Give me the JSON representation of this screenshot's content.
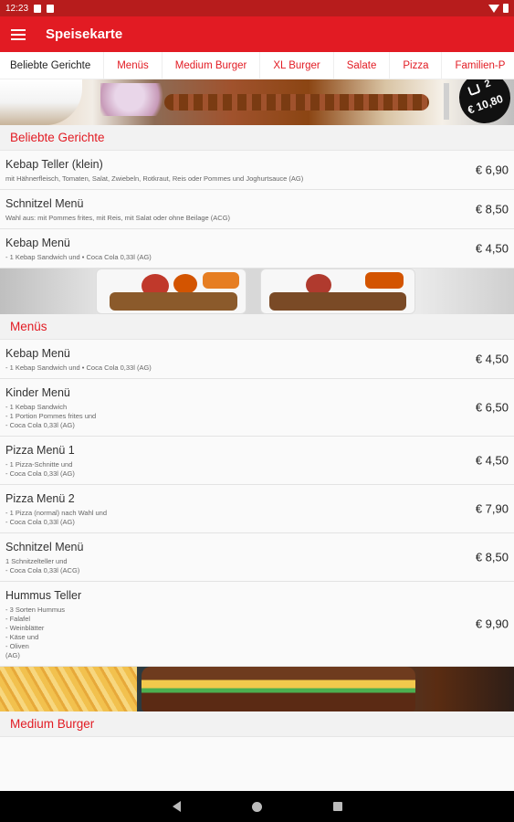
{
  "status_bar": {
    "time": "12:23"
  },
  "app_bar": {
    "title": "Speisekarte"
  },
  "tabs": [
    "Beliebte Gerichte",
    "Menüs",
    "Medium Burger",
    "XL Burger",
    "Salate",
    "Pizza",
    "Familien-P"
  ],
  "cart": {
    "count": "2",
    "total": "€ 10,80"
  },
  "sections": [
    {
      "title": "Beliebte Gerichte",
      "items": [
        {
          "name": "Kebap Teller (klein)",
          "description": "mit Hähnerfleisch, Tomaten, Salat, Zwiebeln, Rotkraut, Reis oder Pommes und Joghurtsauce (AG)",
          "price": "€ 6,90"
        },
        {
          "name": "Schnitzel Menü",
          "description": "Wahl aus: mit Pommes frites, mit Reis, mit Salat oder ohne Beilage (ACG)",
          "price": "€ 8,50"
        },
        {
          "name": "Kebap Menü",
          "description": "- 1 Kebap Sandwich und   • Coca Cola 0,33l  (AG)",
          "price": "€ 4,50"
        }
      ]
    },
    {
      "title": "Menüs",
      "items": [
        {
          "name": "Kebap Menü",
          "description": "- 1 Kebap Sandwich und   • Coca Cola 0,33l  (AG)",
          "price": "€ 4,50"
        },
        {
          "name": "Kinder Menü",
          "description": "- 1 Kebap Sandwich\n- 1 Portion Pommes frites und\n- Coca Cola 0,33l  (AG)",
          "price": "€ 6,50"
        },
        {
          "name": "Pizza Menü 1",
          "description": "- 1 Pizza-Schnitte und\n- Coca Cola 0,33l  (AG)",
          "price": "€ 4,50"
        },
        {
          "name": "Pizza Menü 2",
          "description": "- 1 Pizza (normal) nach Wahl und\n- Coca Cola 0,33l  (AG)",
          "price": "€ 7,90"
        },
        {
          "name": "Schnitzel Menü",
          "description": "1 Schnitzelteller und\n- Coca Cola 0,33l (ACG)",
          "price": "€ 8,50"
        },
        {
          "name": "Hummus Teller",
          "description": "- 3 Sorten Hummus\n- Falafel\n- Weinblätter\n- Käse und\n- Oliven\n(AG)",
          "price": "€ 9,90"
        }
      ]
    },
    {
      "title": "Medium Burger",
      "items": []
    }
  ]
}
